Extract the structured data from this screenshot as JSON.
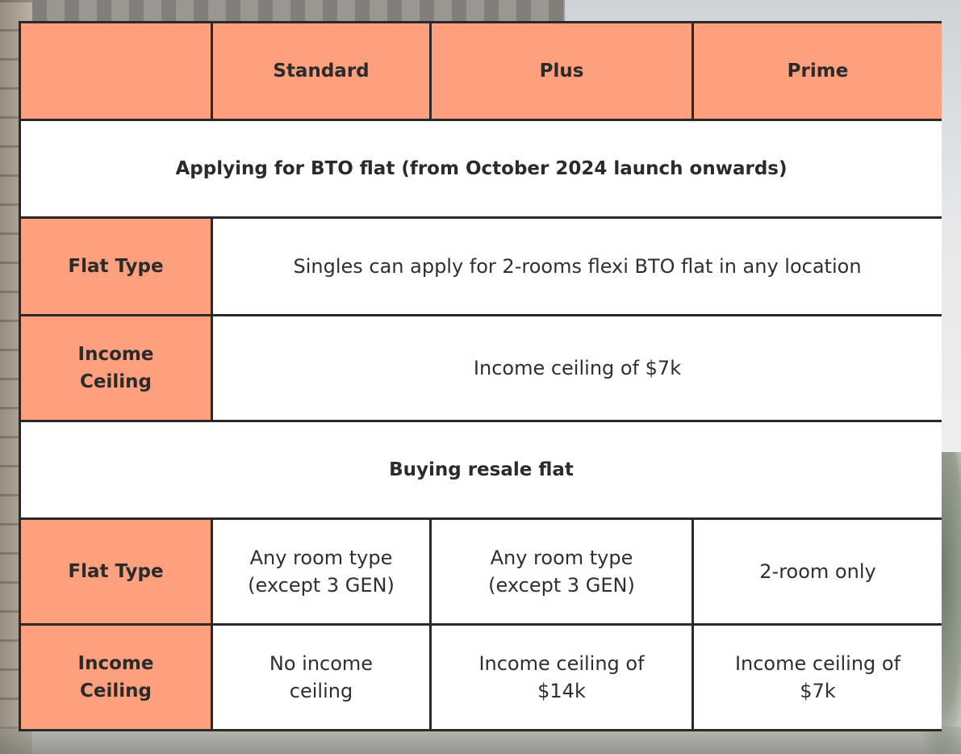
{
  "header": {
    "empty": "",
    "standard": "Standard",
    "plus": "Plus",
    "prime": "Prime"
  },
  "bto": {
    "section_title": "Applying for BTO flat (from October 2024 launch onwards)",
    "flat_type_label": "Flat Type",
    "flat_type_value": "Singles can apply for 2-rooms flexi BTO flat in any location",
    "income_label": "Income\nCeiling",
    "income_value": "Income ceiling of $7k"
  },
  "resale": {
    "section_title": "Buying resale flat",
    "flat_type_label": "Flat Type",
    "flat_type_standard": "Any room type\n(except 3 GEN)",
    "flat_type_plus": "Any room type\n(except 3 GEN)",
    "flat_type_prime": "2-room only",
    "income_label": "Income\nCeiling",
    "income_standard": "No income\nceiling",
    "income_plus": "Income ceiling of\n$14k",
    "income_prime": "Income ceiling of\n$7k"
  },
  "colors": {
    "accent": "#fe9f7d",
    "border": "#2a2a2a",
    "cell": "#ffffff",
    "text": "#2b2b2b"
  }
}
